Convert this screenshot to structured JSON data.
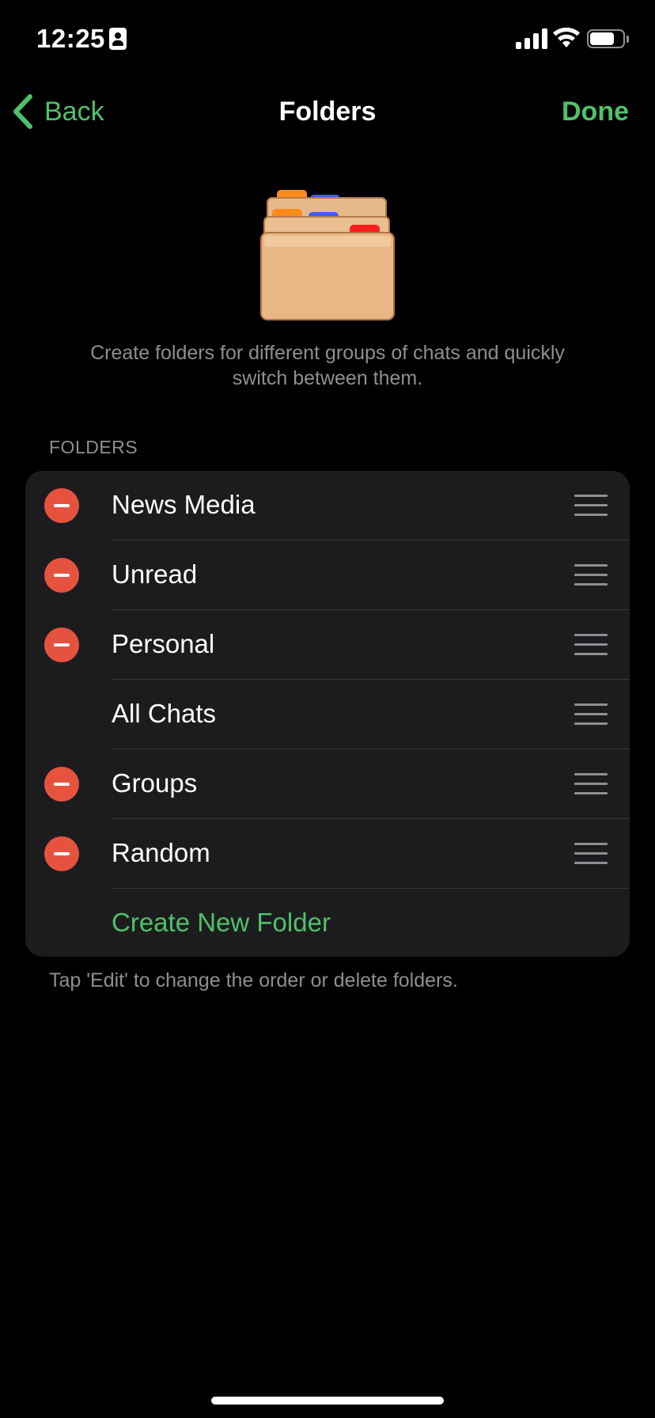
{
  "status_bar": {
    "time": "12:25",
    "battery_level": 0.75
  },
  "nav": {
    "back_label": "Back",
    "title": "Folders",
    "done_label": "Done"
  },
  "intro_text": "Create folders for different groups of chats and quickly switch between them.",
  "section_header": "FOLDERS",
  "folders": [
    {
      "name": "News Media",
      "deletable": true
    },
    {
      "name": "Unread",
      "deletable": true
    },
    {
      "name": "Personal",
      "deletable": true
    },
    {
      "name": "All Chats",
      "deletable": false
    },
    {
      "name": "Groups",
      "deletable": true
    },
    {
      "name": "Random",
      "deletable": true
    }
  ],
  "create_label": "Create New Folder",
  "footer_note": "Tap 'Edit' to change the order or delete folders.",
  "colors": {
    "accent": "#4fc16a",
    "delete": "#e5533f",
    "background": "#000000",
    "cell": "#1c1c1e"
  },
  "icons": [
    "contact-card-icon",
    "signal-icon",
    "wifi-icon",
    "battery-icon",
    "back-chevron-icon",
    "folder-cabinet-icon",
    "delete-icon",
    "drag-handle-icon"
  ]
}
